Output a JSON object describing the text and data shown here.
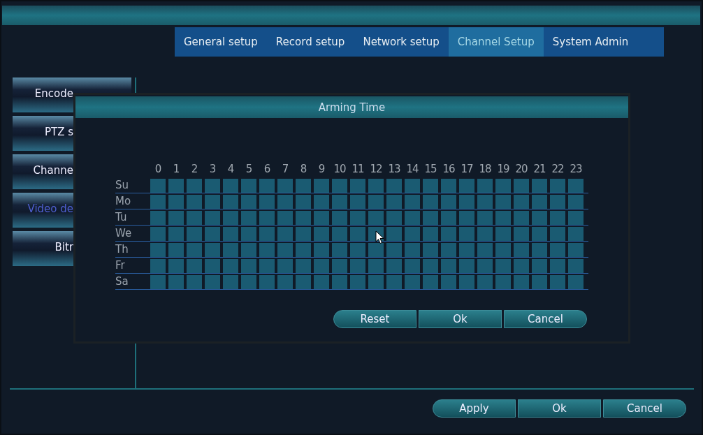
{
  "tabs": [
    {
      "label": "General setup",
      "selected": false
    },
    {
      "label": "Record setup",
      "selected": false
    },
    {
      "label": "Network setup",
      "selected": false
    },
    {
      "label": "Channel Setup",
      "selected": true
    },
    {
      "label": "System Admin",
      "selected": false
    }
  ],
  "sidebar": {
    "items": [
      {
        "label": "Encode",
        "selected": false
      },
      {
        "label": "PTZ s",
        "selected": false
      },
      {
        "label": "Channe",
        "selected": false
      },
      {
        "label": "Video de",
        "selected": true
      },
      {
        "label": "Bitr",
        "selected": false
      }
    ]
  },
  "dialog": {
    "title": "Arming Time",
    "hours": [
      "0",
      "1",
      "2",
      "3",
      "4",
      "5",
      "6",
      "7",
      "8",
      "9",
      "10",
      "11",
      "12",
      "13",
      "14",
      "15",
      "16",
      "17",
      "18",
      "19",
      "20",
      "21",
      "22",
      "23"
    ],
    "days": [
      {
        "label": "Su",
        "slots": [
          true,
          true,
          true,
          true,
          true,
          true,
          true,
          true,
          true,
          true,
          true,
          true,
          true,
          true,
          true,
          true,
          true,
          true,
          true,
          true,
          true,
          true,
          true,
          true
        ]
      },
      {
        "label": "Mo",
        "slots": [
          true,
          true,
          true,
          true,
          true,
          true,
          true,
          true,
          true,
          true,
          true,
          true,
          true,
          true,
          true,
          true,
          true,
          true,
          true,
          true,
          true,
          true,
          true,
          true
        ]
      },
      {
        "label": "Tu",
        "slots": [
          true,
          true,
          true,
          true,
          true,
          true,
          true,
          true,
          true,
          true,
          true,
          true,
          true,
          true,
          true,
          true,
          true,
          true,
          true,
          true,
          true,
          true,
          true,
          true
        ]
      },
      {
        "label": "We",
        "slots": [
          true,
          true,
          true,
          true,
          true,
          true,
          true,
          true,
          true,
          true,
          true,
          true,
          true,
          true,
          true,
          true,
          true,
          true,
          true,
          true,
          true,
          true,
          true,
          true
        ]
      },
      {
        "label": "Th",
        "slots": [
          true,
          true,
          true,
          true,
          true,
          true,
          true,
          true,
          true,
          true,
          true,
          true,
          true,
          true,
          true,
          true,
          true,
          true,
          true,
          true,
          true,
          true,
          true,
          true
        ]
      },
      {
        "label": "Fr",
        "slots": [
          true,
          true,
          true,
          true,
          true,
          true,
          true,
          true,
          true,
          true,
          true,
          true,
          true,
          true,
          true,
          true,
          true,
          true,
          true,
          true,
          true,
          true,
          true,
          true
        ]
      },
      {
        "label": "Sa",
        "slots": [
          true,
          true,
          true,
          true,
          true,
          true,
          true,
          true,
          true,
          true,
          true,
          true,
          true,
          true,
          true,
          true,
          true,
          true,
          true,
          true,
          true,
          true,
          true,
          true
        ]
      }
    ],
    "buttons": [
      "Reset",
      "Ok",
      "Cancel"
    ]
  },
  "buttons": [
    "Apply",
    "Ok",
    "Cancel"
  ]
}
